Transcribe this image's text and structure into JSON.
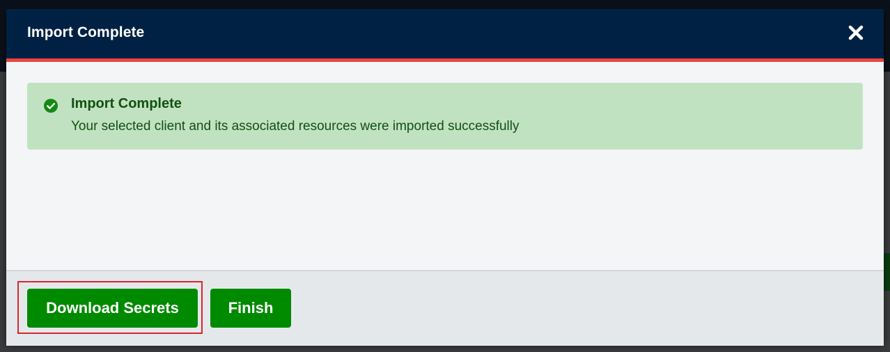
{
  "modal": {
    "title": "Import Complete",
    "close_icon": "close-icon"
  },
  "alert": {
    "icon": "check-circle-icon",
    "title": "Import Complete",
    "message": "Your selected client and its associated resources were imported successfully"
  },
  "footer": {
    "download_label": "Download Secrets",
    "finish_label": "Finish"
  },
  "colors": {
    "header_bg": "#002143",
    "header_accent": "#e8463f",
    "alert_bg": "#c1e2c1",
    "alert_text": "#134f13",
    "button_bg": "#008a00",
    "highlight": "#d8262e"
  }
}
